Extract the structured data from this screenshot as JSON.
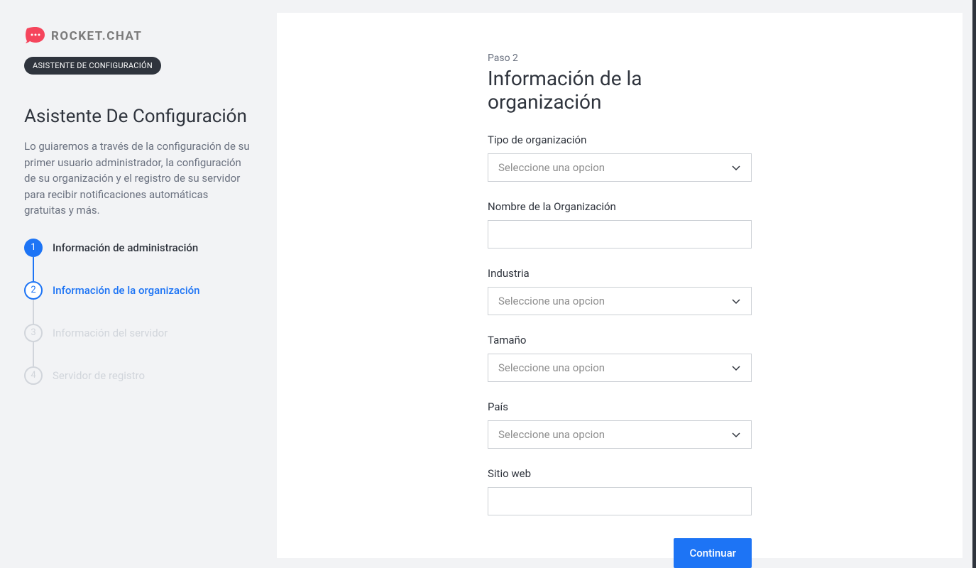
{
  "brand": {
    "name": "ROCKET.CHAT",
    "badge": "ASISTENTE DE CONFIGURACIÓN"
  },
  "sidebar": {
    "title": "Asistente De Configuración",
    "description": "Lo guiaremos a través de la configuración de su primer usuario administrador, la configuración de su organización y el registro de su servidor para recibir notificaciones automáticas gratuitas y más.",
    "steps": [
      {
        "num": "1",
        "label": "Información de administración",
        "state": "completed"
      },
      {
        "num": "2",
        "label": "Información de la organización",
        "state": "active"
      },
      {
        "num": "3",
        "label": "Información del servidor",
        "state": "pending"
      },
      {
        "num": "4",
        "label": "Servidor de registro",
        "state": "pending"
      }
    ]
  },
  "form": {
    "step_indicator": "Paso 2",
    "title": "Información de la organización",
    "select_placeholder": "Seleccione una opcion",
    "fields": {
      "org_type": {
        "label": "Tipo de organización"
      },
      "org_name": {
        "label": "Nombre de la Organización"
      },
      "industry": {
        "label": "Industria"
      },
      "size": {
        "label": "Tamaño"
      },
      "country": {
        "label": "País"
      },
      "website": {
        "label": "Sitio web"
      }
    },
    "submit": "Continuar"
  }
}
